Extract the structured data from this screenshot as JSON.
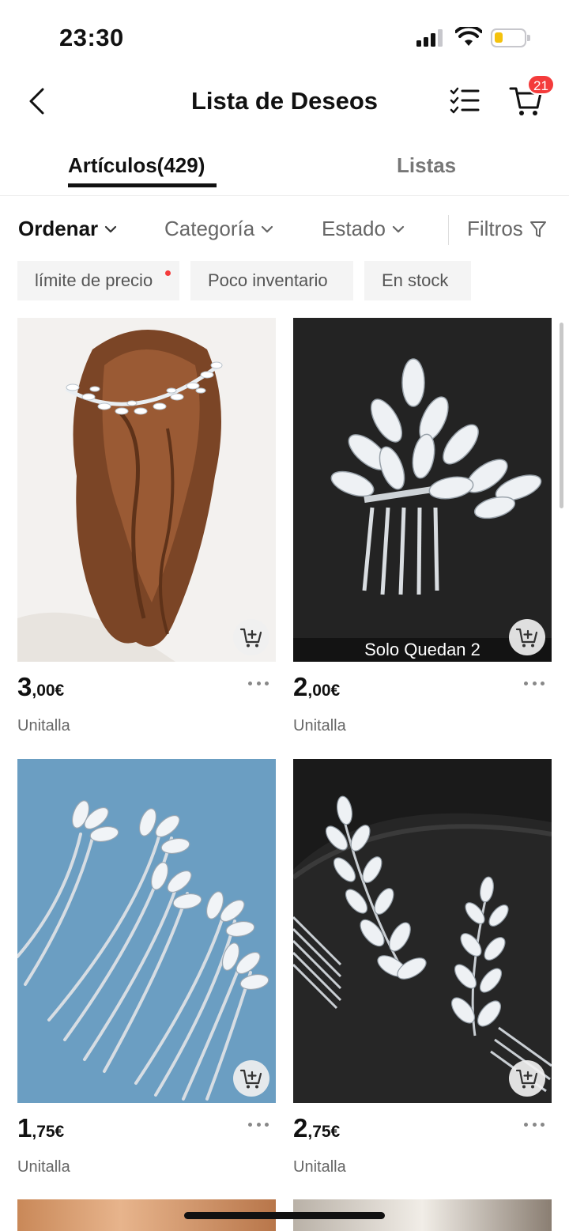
{
  "status_bar": {
    "time": "23:30"
  },
  "header": {
    "title": "Lista de Deseos",
    "cart_count": "21"
  },
  "tabs": [
    {
      "label": "Artículos(429)",
      "active": true
    },
    {
      "label": "Listas",
      "active": false
    }
  ],
  "filters": {
    "sort": "Ordenar",
    "category": "Categoría",
    "state": "Estado",
    "filters": "Filtros"
  },
  "chips": [
    "límite de precio",
    "Poco inventario",
    "En stock"
  ],
  "products": [
    {
      "price_int": "3",
      "price_dec": ",00€",
      "size": "Unitalla",
      "stock_note": ""
    },
    {
      "price_int": "2",
      "price_dec": ",00€",
      "size": "Unitalla",
      "stock_note": "Solo Quedan 2"
    },
    {
      "price_int": "1",
      "price_dec": ",75€",
      "size": "Unitalla",
      "stock_note": ""
    },
    {
      "price_int": "2",
      "price_dec": ",75€",
      "size": "Unitalla",
      "stock_note": ""
    }
  ],
  "colors": {
    "accent": "#f43b3b",
    "text": "#111111",
    "muted": "#666666",
    "chip_bg": "#f4f4f4",
    "battery": "#f4c20d"
  },
  "icons": {
    "back": "chevron-left-icon",
    "checklist": "checklist-icon",
    "cart": "cart-icon",
    "filter": "funnel-icon",
    "add_to_cart": "add-to-cart-icon",
    "more": "more-dots-icon"
  }
}
